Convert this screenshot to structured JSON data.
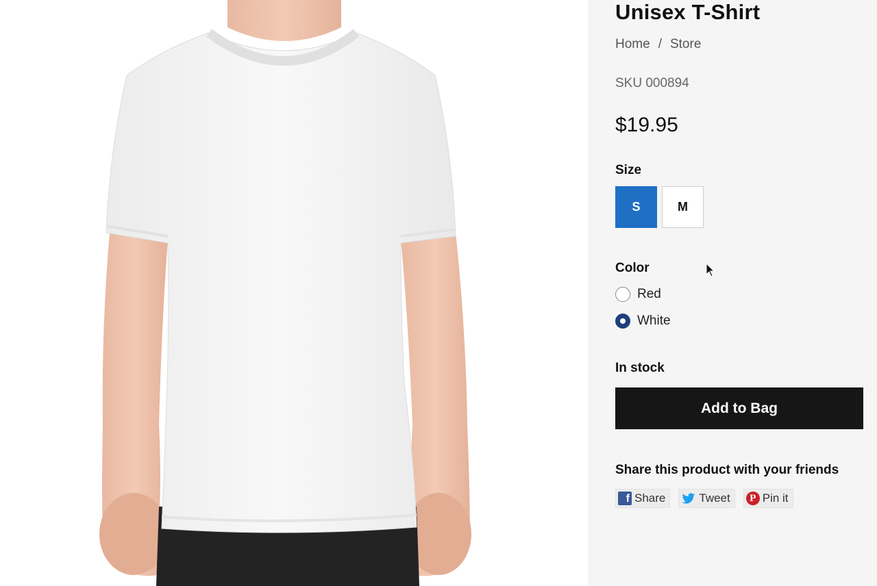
{
  "product": {
    "title": "Unisex T-Shirt",
    "sku": "SKU 000894",
    "price": "$19.95",
    "stock_status": "In stock",
    "image_alt": "person wearing white t-shirt"
  },
  "breadcrumb": {
    "home": "Home",
    "separator": "/",
    "store": "Store"
  },
  "size": {
    "label": "Size",
    "options": [
      "S",
      "M"
    ],
    "selected": "S"
  },
  "color": {
    "label": "Color",
    "options": [
      "Red",
      "White"
    ],
    "selected": "White"
  },
  "cart": {
    "add_label": "Add to Bag"
  },
  "share": {
    "title": "Share this product with your friends",
    "facebook_label": "Share",
    "twitter_label": "Tweet",
    "pinterest_label": "Pin it"
  },
  "icons": {
    "facebook": "facebook-icon",
    "twitter": "twitter-icon",
    "pinterest": "pinterest-icon"
  },
  "colors": {
    "selected_size_bg": "#1f6fc5",
    "add_button_bg": "#161616",
    "panel_bg": "#f5f5f5",
    "radio_checked": "#1e3f7a"
  }
}
